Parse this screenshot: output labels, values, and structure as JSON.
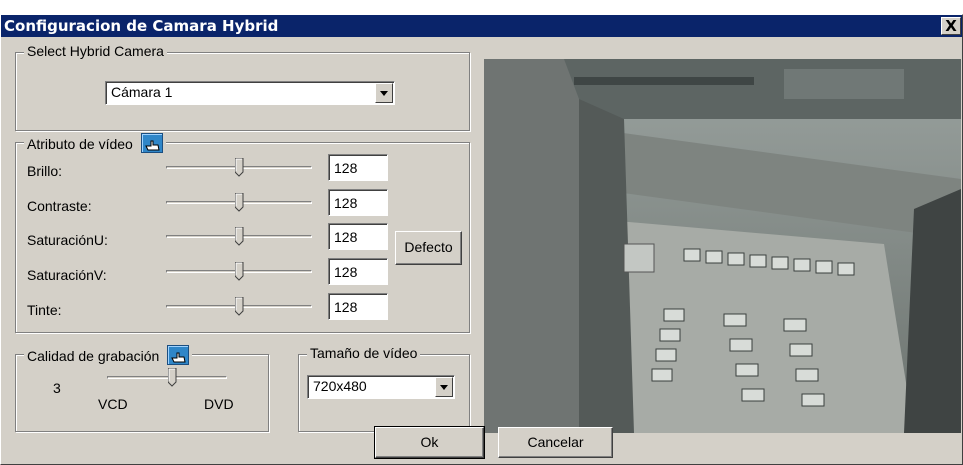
{
  "window": {
    "title": "Configuracion de Camara Hybrid",
    "close_label": "X"
  },
  "camera_group": {
    "legend": "Select Hybrid Camera",
    "selected": "Cámara 1"
  },
  "video_attr": {
    "legend": "Atributo de vídeo",
    "rows": [
      {
        "label": "Brillo:",
        "value": "128",
        "level": 0.5
      },
      {
        "label": "Contraste:",
        "value": "128",
        "level": 0.5
      },
      {
        "label": "SaturaciónU:",
        "value": "128",
        "level": 0.5
      },
      {
        "label": "SaturaciónV:",
        "value": "128",
        "level": 0.5
      },
      {
        "label": "Tinte:",
        "value": "128",
        "level": 0.5
      }
    ],
    "default_button": "Defecto"
  },
  "quality": {
    "legend": "Calidad de grabación",
    "value": "3",
    "min_label": "VCD",
    "max_label": "DVD",
    "level": 0.55
  },
  "video_size": {
    "legend": "Tamaño de vídeo",
    "selected": "720x480"
  },
  "buttons": {
    "ok": "Ok",
    "cancel": "Cancelar"
  },
  "icons": {
    "legend_icon": "hand-pointer-icon",
    "accent": "#2f86c8",
    "title_bg": "#0a246a"
  }
}
